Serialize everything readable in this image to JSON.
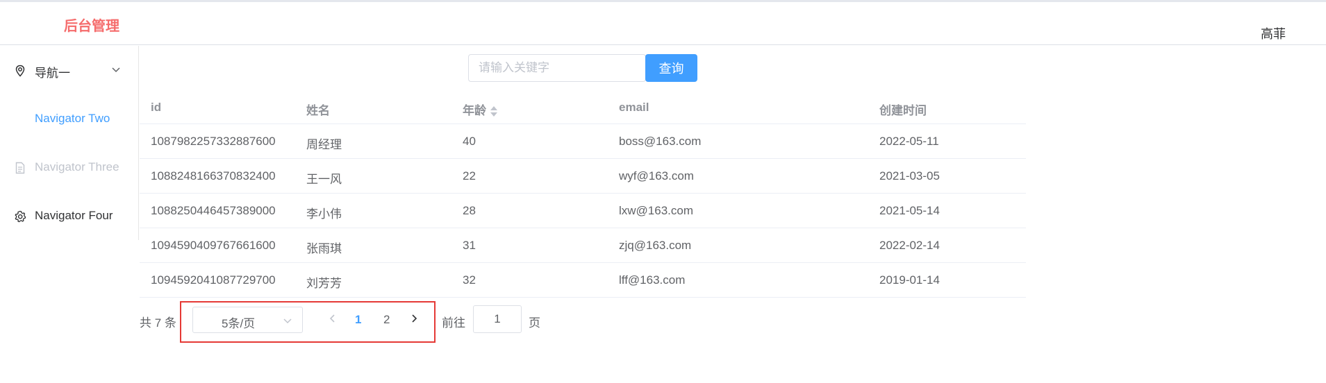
{
  "header": {
    "brand": "后台管理",
    "username": "高菲"
  },
  "sidebar": {
    "items": [
      {
        "label": "导航一",
        "icon": "location-icon",
        "state": "normal",
        "has_submenu": true
      },
      {
        "label": "Navigator Two",
        "icon": "",
        "state": "active"
      },
      {
        "label": "Navigator Three",
        "icon": "document-icon",
        "state": "disabled"
      },
      {
        "label": "Navigator Four",
        "icon": "gear-icon",
        "state": "normal"
      }
    ]
  },
  "search": {
    "placeholder": "请输入关键字",
    "value": "",
    "button_label": "查询"
  },
  "table": {
    "columns": [
      "id",
      "姓名",
      "年龄",
      "email",
      "创建时间"
    ],
    "sortable_column": "年龄",
    "rows": [
      [
        "1087982257332887600",
        "周经理",
        "40",
        "boss@163.com",
        "2022-05-11"
      ],
      [
        "1088248166370832400",
        "王一风",
        "22",
        "wyf@163.com",
        "2021-03-05"
      ],
      [
        "1088250446457389000",
        "李小伟",
        "28",
        "lxw@163.com",
        "2021-05-14"
      ],
      [
        "1094590409767661600",
        "张雨琪",
        "31",
        "zjq@163.com",
        "2022-02-14"
      ],
      [
        "1094592041087729700",
        "刘芳芳",
        "32",
        "lff@163.com",
        "2019-01-14"
      ]
    ]
  },
  "pagination": {
    "total_text": "共 7 条",
    "page_size": "5条/页",
    "pages": [
      "1",
      "2"
    ],
    "current_page": "1",
    "goto_label": "前往",
    "jump_value": "1",
    "page_unit": "页"
  },
  "colors": {
    "brand": "#f56c6c",
    "accent": "#409eff",
    "highlight": "#e53935"
  }
}
